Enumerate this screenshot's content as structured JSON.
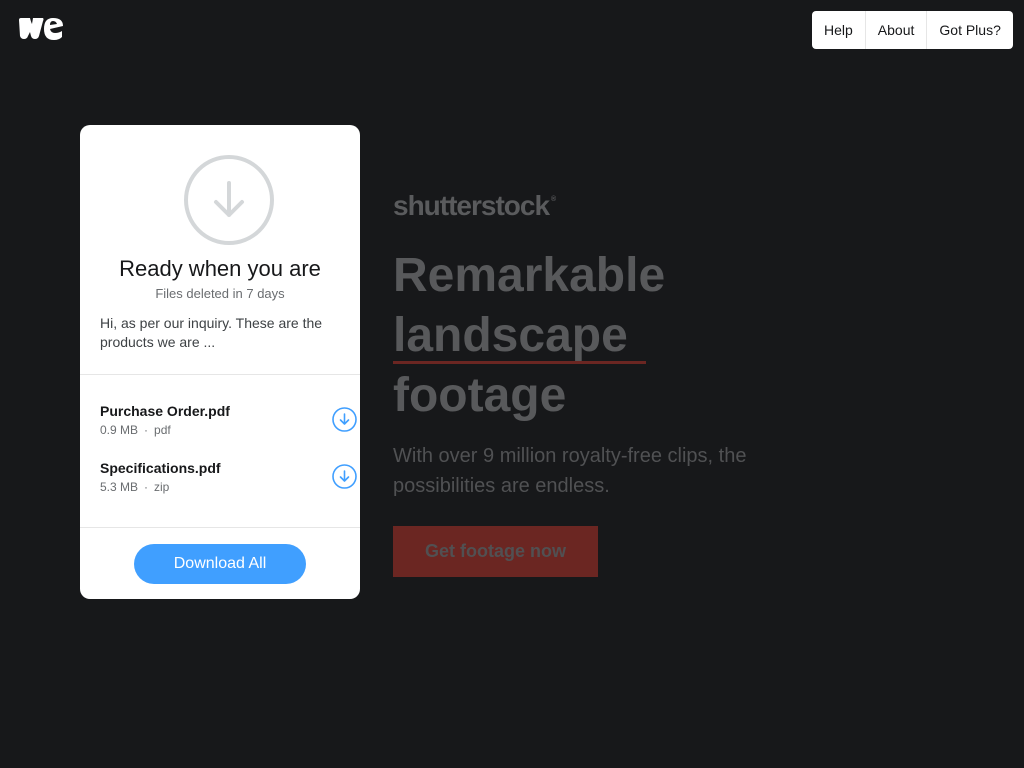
{
  "logo": {
    "icon": "wetransfer-logo"
  },
  "nav": {
    "items": [
      {
        "label": "Help"
      },
      {
        "label": "About"
      },
      {
        "label": "Got Plus?"
      }
    ]
  },
  "ad": {
    "brand": "shutterstock",
    "brand_mark": "®",
    "headline_line1": "Remarkable",
    "headline_line2": "landscape",
    "headline_line3": "footage",
    "subtext": "With over 9 million royalty-free clips, the possibilities are endless.",
    "cta": "Get footage now",
    "colors": {
      "accent": "#6b2622",
      "text": "#58595b"
    }
  },
  "transfer": {
    "icon": "download-circle-icon",
    "title": "Ready when you are",
    "subtitle": "Files deleted in 7 days",
    "message": "Hi, as per our inquiry. These are the products we are ...",
    "files": [
      {
        "name": "Purchase Order.pdf",
        "size": "0.9 MB",
        "type": "pdf"
      },
      {
        "name": "Specifications.pdf",
        "size": "5.3 MB",
        "type": "zip"
      }
    ],
    "meta_separator": "·",
    "download_all": "Download All",
    "colors": {
      "primary": "#409fff",
      "icon_ring": "#d4d7d9"
    }
  }
}
